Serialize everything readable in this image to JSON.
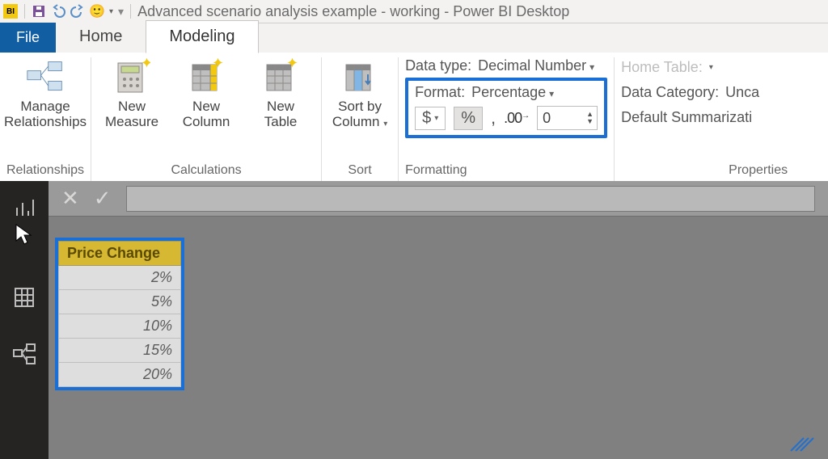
{
  "titlebar": {
    "title": "Advanced scenario analysis example - working - Power BI Desktop",
    "app_icon_label": "BI"
  },
  "tabs": {
    "file": "File",
    "home": "Home",
    "modeling": "Modeling"
  },
  "ribbon": {
    "relationships": {
      "manage": "Manage\nRelationships",
      "group_label": "Relationships"
    },
    "calculations": {
      "new_measure": "New\nMeasure",
      "new_column": "New\nColumn",
      "new_table": "New\nTable",
      "group_label": "Calculations"
    },
    "sort": {
      "sort_by_column": "Sort by\nColumn",
      "group_label": "Sort"
    },
    "formatting": {
      "data_type_label": "Data type:",
      "data_type_value": "Decimal Number",
      "format_label": "Format:",
      "format_value": "Percentage",
      "currency_symbol": "$",
      "percent_symbol": "%",
      "thousands_symbol": ",",
      "decimal_icon": ".00 .0",
      "decimal_places_value": "0",
      "group_label": "Formatting"
    },
    "properties": {
      "home_table_label": "Home Table:",
      "data_category_label": "Data Category:",
      "data_category_value": "Unca",
      "default_summarization_label": "Default Summarizati",
      "group_label": "Properties"
    }
  },
  "data_view": {
    "column_header": "Price Change",
    "rows": [
      "2%",
      "5%",
      "10%",
      "15%",
      "20%"
    ]
  }
}
